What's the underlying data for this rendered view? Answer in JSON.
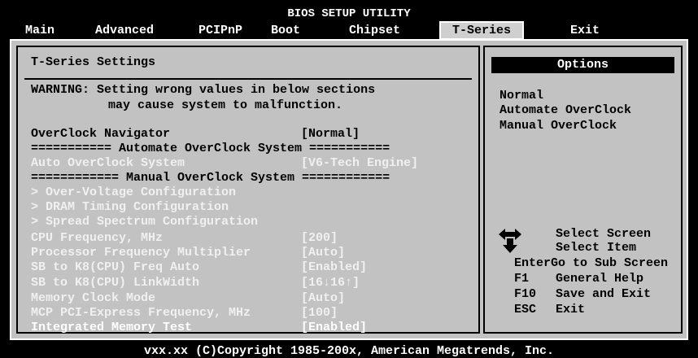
{
  "header": {
    "title": "BIOS SETUP UTILITY",
    "menu": [
      "Main",
      "Advanced",
      "PCIPnP",
      "Boot",
      "Chipset",
      "T-Series",
      "Exit"
    ],
    "active": "T-Series"
  },
  "left": {
    "section_title": "T-Series Settings",
    "warning_line1": "WARNING: Setting wrong values in below sections",
    "warning_line2": "may cause system to malfunction.",
    "items": [
      {
        "label": "OverClock Navigator",
        "value": "[Normal]"
      },
      {
        "label": "=========== Automate OverClock System ===========",
        "value": ""
      },
      {
        "label": "Auto OverClock System",
        "value": "[V6-Tech Engine]"
      },
      {
        "label": "============ Manual OverClock System ============",
        "value": ""
      },
      {
        "label": "> Over-Voltage Configuration",
        "value": ""
      },
      {
        "label": "> DRAM Timing Configuration",
        "value": ""
      },
      {
        "label": "> Spread Spectrum Configuration",
        "value": ""
      },
      {
        "label": "CPU Frequency, MHz",
        "value": "[200]"
      },
      {
        "label": "Processor Frequency Multiplier",
        "value": "[Auto]"
      },
      {
        "label": "SB to K8(CPU) Freq Auto",
        "value": "[Enabled]"
      },
      {
        "label": "SB to K8(CPU) LinkWidth",
        "value": "[16↓16↑]"
      },
      {
        "label": "Memory Clock Mode",
        "value": "[Auto]"
      },
      {
        "label": "MCP PCI-Express Frequency, MHz",
        "value": "[100]"
      },
      {
        "label": "Integrated Memory Test",
        "value": "[Enabled]"
      }
    ]
  },
  "right": {
    "options_title": "Options",
    "options": [
      "Normal",
      "Automate OverClock",
      "Manual OverClock"
    ],
    "help": [
      {
        "key": "",
        "text": "Select Screen"
      },
      {
        "key": "",
        "text": "Select Item"
      },
      {
        "key": "Enter",
        "text": "Go to Sub Screen"
      },
      {
        "key": "F1",
        "text": "General Help"
      },
      {
        "key": "F10",
        "text": "Save and Exit"
      },
      {
        "key": "ESC",
        "text": "Exit"
      }
    ]
  },
  "footer": "vxx.xx (C)Copyright 1985-200x, American Megatrends, Inc.",
  "colors": {
    "panel": "#c2c2c2",
    "background": "#000000",
    "text_dark": "#000000",
    "text_light": "#f0f0f0"
  },
  "icons": {
    "nav": "arrow-keys-icon"
  }
}
